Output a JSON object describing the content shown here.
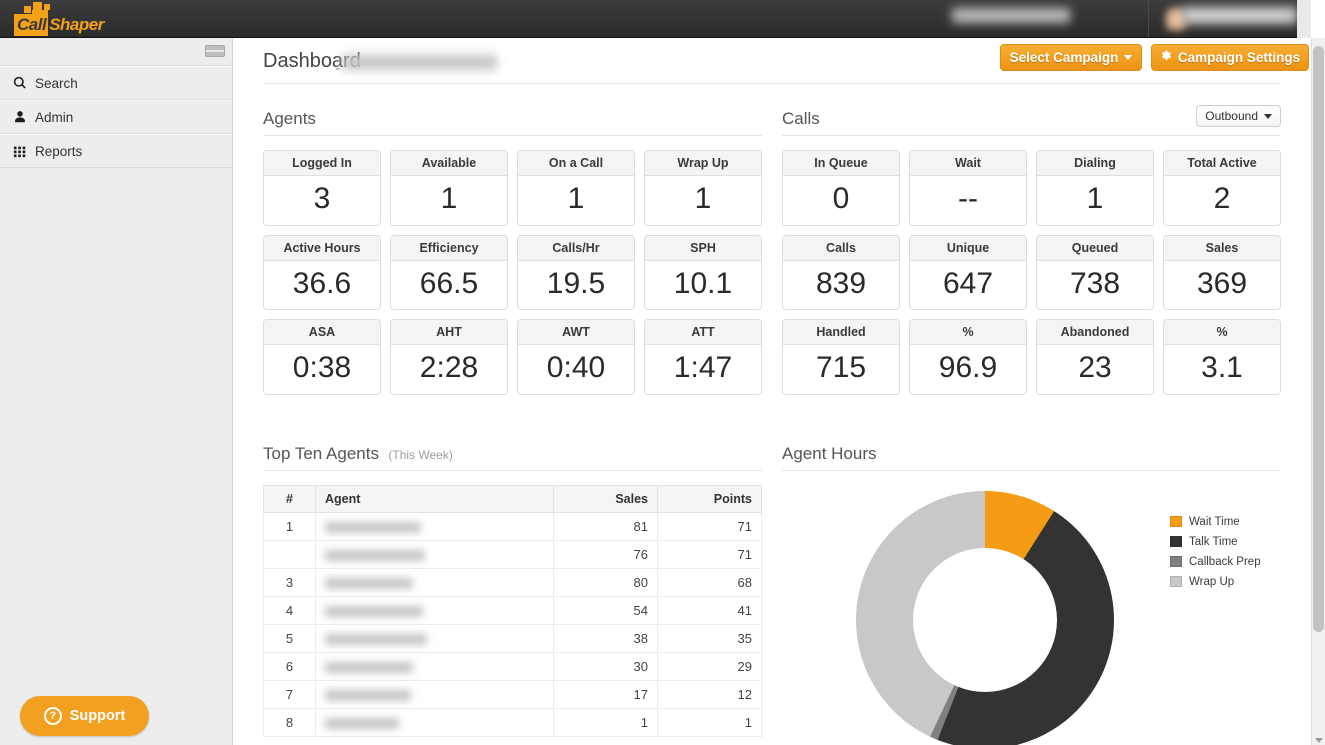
{
  "brand": {
    "logo_call": "Call",
    "logo_shaper": "Shaper",
    "accent_orange": "#f2a01f"
  },
  "sidebar": {
    "items": [
      {
        "label": "Search",
        "icon": "search-icon"
      },
      {
        "label": "Admin",
        "icon": "user-icon"
      },
      {
        "label": "Reports",
        "icon": "grid-icon"
      }
    ],
    "support_label": "Support"
  },
  "header": {
    "page_title": "Dashboard",
    "title_separator": "-",
    "select_campaign_label": "Select Campaign",
    "campaign_settings_label": "Campaign Settings"
  },
  "agents": {
    "section_title": "Agents",
    "cards": [
      {
        "label": "Logged In",
        "value": "3"
      },
      {
        "label": "Available",
        "value": "1"
      },
      {
        "label": "On a Call",
        "value": "1"
      },
      {
        "label": "Wrap Up",
        "value": "1"
      },
      {
        "label": "Active Hours",
        "value": "36.6"
      },
      {
        "label": "Efficiency",
        "value": "66.5"
      },
      {
        "label": "Calls/Hr",
        "value": "19.5"
      },
      {
        "label": "SPH",
        "value": "10.1"
      },
      {
        "label": "ASA",
        "value": "0:38"
      },
      {
        "label": "AHT",
        "value": "2:28"
      },
      {
        "label": "AWT",
        "value": "0:40"
      },
      {
        "label": "ATT",
        "value": "1:47"
      }
    ]
  },
  "calls": {
    "section_title": "Calls",
    "direction_filter": "Outbound",
    "cards": [
      {
        "label": "In Queue",
        "value": "0"
      },
      {
        "label": "Wait",
        "value": "--"
      },
      {
        "label": "Dialing",
        "value": "1"
      },
      {
        "label": "Total Active",
        "value": "2"
      },
      {
        "label": "Calls",
        "value": "839"
      },
      {
        "label": "Unique",
        "value": "647"
      },
      {
        "label": "Queued",
        "value": "738"
      },
      {
        "label": "Sales",
        "value": "369"
      },
      {
        "label": "Handled",
        "value": "715"
      },
      {
        "label": "%",
        "value": "96.9"
      },
      {
        "label": "Abandoned",
        "value": "23"
      },
      {
        "label": "%",
        "value": "3.1"
      }
    ]
  },
  "top_ten_agents": {
    "section_title": "Top Ten Agents",
    "section_subtitle": "(This Week)",
    "columns": [
      "#",
      "Agent",
      "Sales",
      "Points"
    ],
    "rows": [
      {
        "rank": "1",
        "agent": "",
        "agent_blur_width": 96,
        "sales": "81",
        "points": "71"
      },
      {
        "rank": "",
        "agent": "",
        "agent_blur_width": 100,
        "sales": "76",
        "points": "71"
      },
      {
        "rank": "3",
        "agent": "",
        "agent_blur_width": 88,
        "sales": "80",
        "points": "68"
      },
      {
        "rank": "4",
        "agent": "",
        "agent_blur_width": 98,
        "sales": "54",
        "points": "41"
      },
      {
        "rank": "5",
        "agent": "",
        "agent_blur_width": 102,
        "sales": "38",
        "points": "35"
      },
      {
        "rank": "6",
        "agent": "",
        "agent_blur_width": 88,
        "sales": "30",
        "points": "29"
      },
      {
        "rank": "7",
        "agent": "",
        "agent_blur_width": 86,
        "sales": "17",
        "points": "12"
      },
      {
        "rank": "8",
        "agent": "",
        "agent_blur_width": 74,
        "sales": "1",
        "points": "1"
      }
    ]
  },
  "agent_hours": {
    "section_title": "Agent Hours"
  },
  "chart_data": {
    "type": "pie",
    "title": "Agent Hours",
    "variant": "donut",
    "legend_position": "right",
    "start_angle_deg": 0,
    "labels": [
      "Wait Time",
      "Talk Time",
      "Callback Prep",
      "Wrap Up"
    ],
    "values": [
      9,
      47,
      1,
      43
    ],
    "unit": "percent",
    "colors": [
      "#f59c14",
      "#333333",
      "#808080",
      "#c8c8c8"
    ]
  }
}
